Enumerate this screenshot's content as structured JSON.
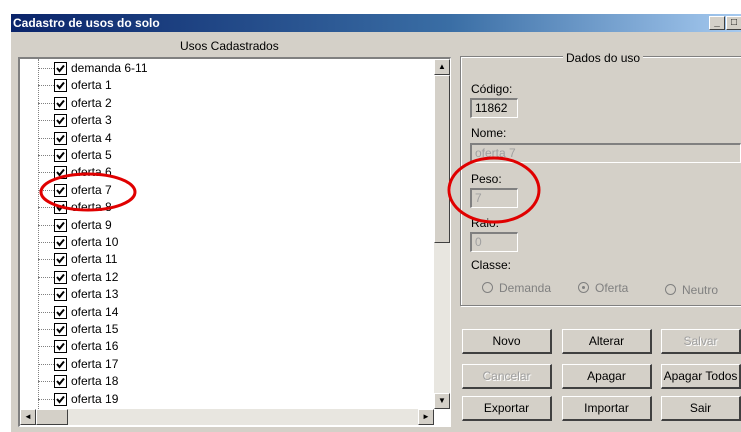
{
  "window": {
    "title": "Cadastro de usos do solo",
    "minimize_glyph": "_",
    "maximize_glyph": "□"
  },
  "tree": {
    "header": "Usos Cadastrados",
    "items": [
      {
        "label": "demanda 6-11",
        "checked": true
      },
      {
        "label": "oferta 1",
        "checked": true
      },
      {
        "label": "oferta 2",
        "checked": true
      },
      {
        "label": "oferta 3",
        "checked": true
      },
      {
        "label": "oferta 4",
        "checked": true
      },
      {
        "label": "oferta 5",
        "checked": true
      },
      {
        "label": "oferta 6",
        "checked": true
      },
      {
        "label": "oferta 7",
        "checked": true
      },
      {
        "label": "oferta 8",
        "checked": true
      },
      {
        "label": "oferta 9",
        "checked": true
      },
      {
        "label": "oferta 10",
        "checked": true
      },
      {
        "label": "oferta 11",
        "checked": true
      },
      {
        "label": "oferta 12",
        "checked": true
      },
      {
        "label": "oferta 13",
        "checked": true
      },
      {
        "label": "oferta 14",
        "checked": true
      },
      {
        "label": "oferta 15",
        "checked": true
      },
      {
        "label": "oferta 16",
        "checked": true
      },
      {
        "label": "oferta 17",
        "checked": true
      },
      {
        "label": "oferta 18",
        "checked": true
      },
      {
        "label": "oferta 19",
        "checked": true
      }
    ],
    "scroll_up_glyph": "▲",
    "scroll_down_glyph": "▼",
    "scroll_left_glyph": "◄",
    "scroll_right_glyph": "►"
  },
  "details": {
    "group_title": "Dados do uso",
    "codigo_label": "Código:",
    "codigo_value": "11862",
    "nome_label": "Nome:",
    "nome_value": "oferta 7",
    "peso_label": "Peso:",
    "peso_value": "7",
    "raio_label": "Raio:",
    "raio_value": "0",
    "classe_label": "Classe:",
    "classe_options": [
      "Demanda",
      "Oferta",
      "Neutro"
    ],
    "classe_selected": "Oferta"
  },
  "buttons": {
    "novo": "Novo",
    "alterar": "Alterar",
    "salvar": "Salvar",
    "cancelar": "Cancelar",
    "apagar": "Apagar",
    "apagar_todos": "Apagar Todos",
    "exportar": "Exportar",
    "importar": "Importar",
    "sair": "Sair"
  },
  "annotations": {
    "highlight_color": "#e00000"
  }
}
